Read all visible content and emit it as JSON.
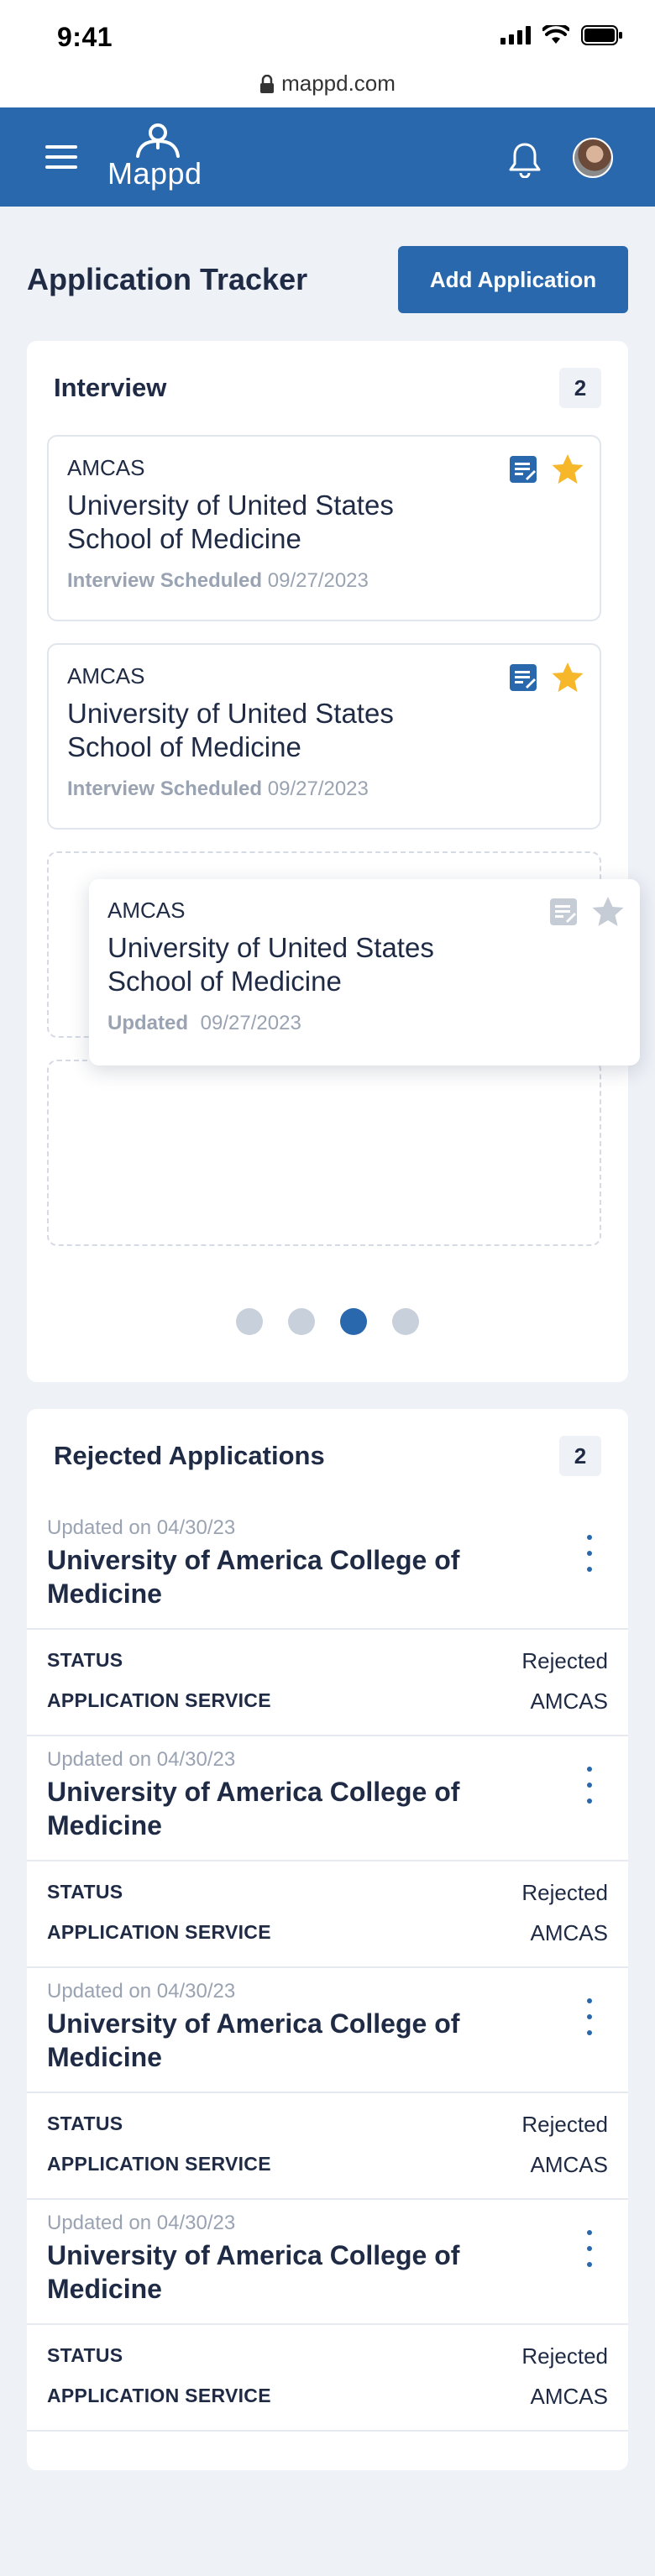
{
  "status_bar": {
    "time": "9:41",
    "url": "mappd.com"
  },
  "header": {
    "logo_text": "Mappd"
  },
  "page": {
    "title": "Application Tracker",
    "add_button": "Add Application"
  },
  "interview": {
    "title": "Interview",
    "count": "2",
    "cards": [
      {
        "service": "AMCAS",
        "school": "University of United States School of Medicine",
        "status_label": "Interview Scheduled",
        "date": "09/27/2023",
        "starred": true
      },
      {
        "service": "AMCAS",
        "school": "University of United States School of Medicine",
        "status_label": "Interview Scheduled",
        "date": "09/27/2023",
        "starred": true
      }
    ],
    "dragging_card": {
      "service": "AMCAS",
      "school": "University of United States School of Medicine",
      "status_label": "Updated",
      "date": "09/27/2023",
      "starred": false
    },
    "pagination": {
      "pages": 4,
      "active_index": 2
    }
  },
  "rejected": {
    "title": "Rejected Applications",
    "count": "2",
    "status_label": "STATUS",
    "service_label": "APPLICATION SERVICE",
    "items": [
      {
        "updated": "Updated on 04/30/23",
        "school": "University of America College of Medicine",
        "status": "Rejected",
        "service": "AMCAS"
      },
      {
        "updated": "Updated on 04/30/23",
        "school": "University of America College of Medicine",
        "status": "Rejected",
        "service": "AMCAS"
      },
      {
        "updated": "Updated on 04/30/23",
        "school": "University of America College of Medicine",
        "status": "Rejected",
        "service": "AMCAS"
      },
      {
        "updated": "Updated on 04/30/23",
        "school": "University of America College of Medicine",
        "status": "Rejected",
        "service": "AMCAS"
      }
    ]
  },
  "colors": {
    "brand": "#2a68ad",
    "star_active": "#f6b82a",
    "star_inactive": "#c5ccd6",
    "muted_text": "#9aa3b2"
  }
}
